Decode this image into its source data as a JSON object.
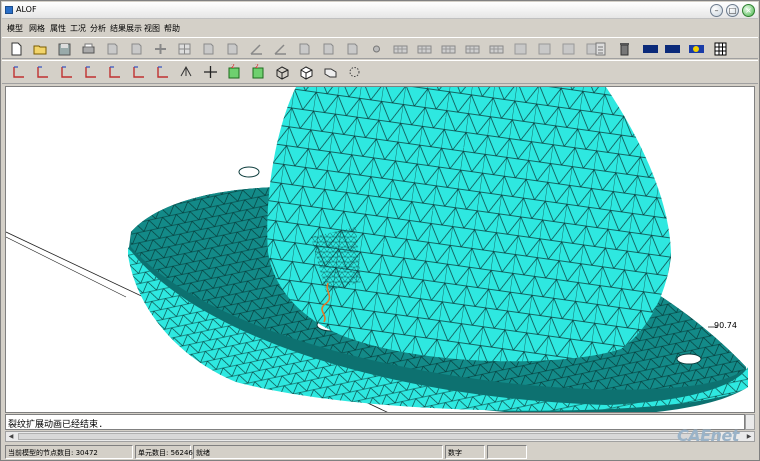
{
  "window": {
    "title": "ALOF"
  },
  "menu": [
    "模型",
    "网格",
    "属性",
    "工况",
    "分析",
    "结果展示",
    "视图",
    "帮助"
  ],
  "toolbar1": [
    "new-icon",
    "open-icon",
    "save-icon",
    "print-icon",
    "doc-icon",
    "doc-icon",
    "move-icon",
    "grid-icon",
    "doc-icon",
    "doc-icon",
    "angle-icon",
    "angle-icon",
    "doc-icon",
    "doc-icon",
    "doc-icon",
    "node-icon",
    "mesh-icon",
    "mesh-icon",
    "mesh-icon",
    "mesh-icon",
    "mesh-icon",
    "block-icon",
    "block-icon",
    "block-icon",
    "block-icon",
    "calculator-icon",
    "trash-icon",
    "flag-icon",
    "flag-icon",
    "palette-icon",
    "table-icon"
  ],
  "toolbar2": [
    "axis-icon",
    "axis-icon",
    "axis-icon",
    "axis-icon",
    "axis-icon",
    "axis-icon",
    "axis-icon",
    "rotate-icon",
    "pan-icon",
    "zoom-box-icon",
    "zoom-box-icon",
    "wire-cube-icon",
    "shaded-cube-icon",
    "cube-icon",
    "fit-icon"
  ],
  "viewport": {
    "annotation": "90.74"
  },
  "message": "裂纹扩展动画已经结束.",
  "status": {
    "nodes": "当前模型的节点数目: 30472",
    "elements": "单元数目: 56246",
    "state": "就绪",
    "mode": "数字"
  },
  "watermark": "CAEnet",
  "colors": {
    "mesh": "#2ee8e0",
    "mesh_dark": "#0f6e6c",
    "edge": "#0a3a3a",
    "crack": "#e07a2a"
  }
}
